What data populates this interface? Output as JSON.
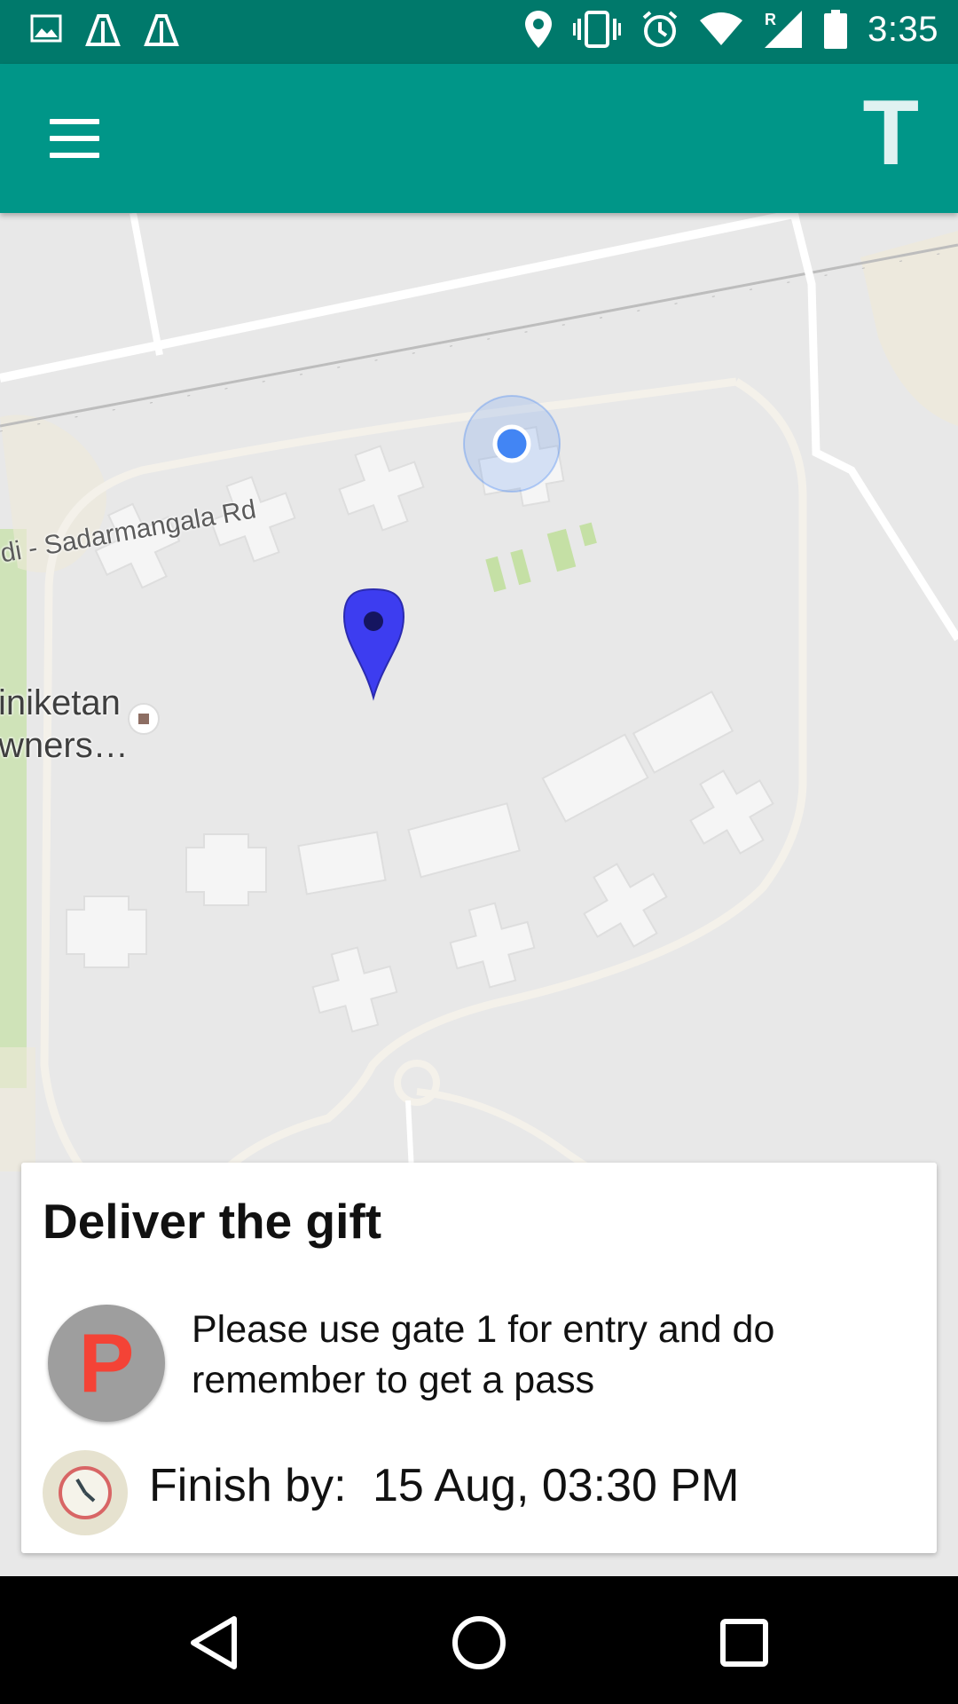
{
  "status_bar": {
    "time": "3:35",
    "left_icons": [
      "gallery-icon",
      "app-notification-icon",
      "app-notification-icon"
    ],
    "right_icons": [
      "location-icon",
      "vibrate-icon",
      "alarm-icon",
      "wifi-icon",
      "signal-roaming-icon",
      "battery-icon"
    ],
    "roaming_indicator": "R"
  },
  "app_bar": {
    "menu_icon": "hamburger-menu-icon",
    "logo_text": "T",
    "background_color": "#009688"
  },
  "map": {
    "road_label": "di - Sadarmangala Rd",
    "poi_label": "iniketan\nwners…",
    "destination_pin_color": "#3d3df0",
    "current_location_color": "#4285f4"
  },
  "task_card": {
    "title": "Deliver the gift",
    "note_avatar_letter": "P",
    "note_text": "Please use gate 1 for entry and do remember to get a pass",
    "due_label": "Finish by: ",
    "due_value": "15 Aug, 03:30 PM"
  },
  "nav_bar": {
    "buttons": [
      "back-icon",
      "home-icon",
      "recents-icon"
    ]
  }
}
